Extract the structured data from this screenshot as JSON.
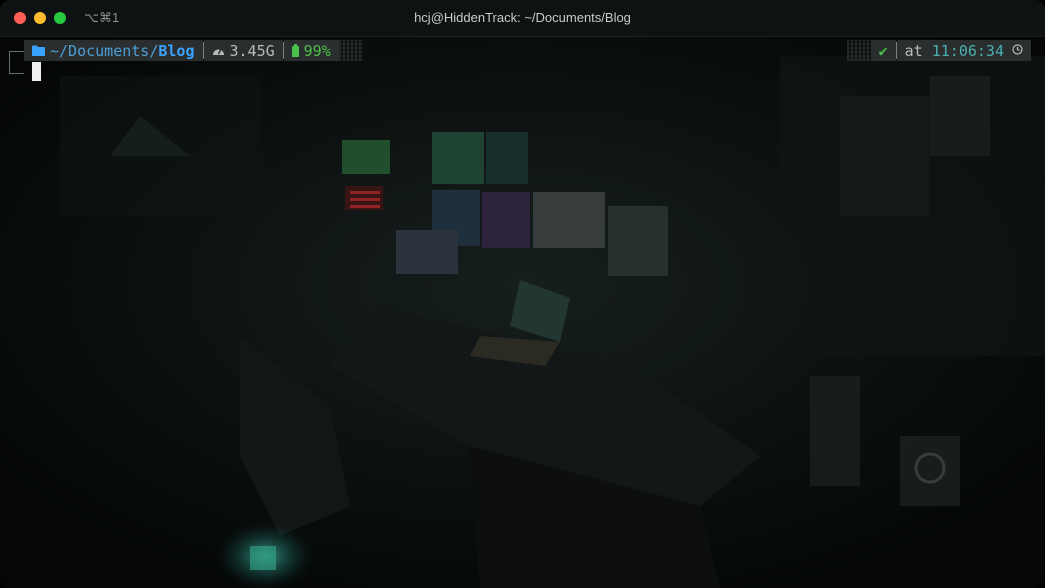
{
  "window": {
    "title": "hcj@HiddenTrack: ~/Documents/Blog",
    "shortcut": "⌥⌘1"
  },
  "prompt": {
    "path_prefix": "~/Documents/",
    "path_current": "Blog",
    "memory": "3.45G",
    "battery": "99%",
    "status": "✔",
    "time_label": "at",
    "time": "11:06:34"
  },
  "icons": {
    "folder": "folder-icon",
    "gauge": "gauge-icon",
    "battery": "battery-icon",
    "clock": "clock-icon"
  },
  "colors": {
    "path": "#3aa2ff",
    "battery": "#4ac14a",
    "status_ok": "#4ac14a",
    "time": "#4ab0b0",
    "segment_bg": "#2b2e2e"
  }
}
